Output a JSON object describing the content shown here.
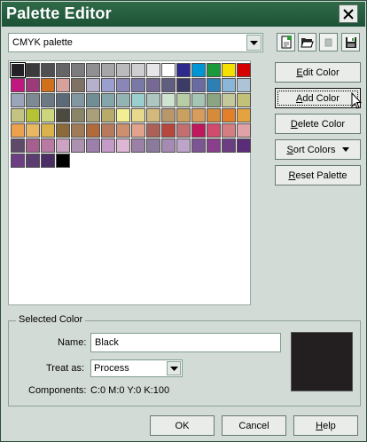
{
  "window": {
    "title": "Palette Editor"
  },
  "palette": {
    "selected": "CMYK palette",
    "swatches": [
      [
        "#222226",
        "#3b3b3e",
        "#505053",
        "#656568",
        "#7c7c7e",
        "#909092",
        "#a6a6a8",
        "#bbbbbd",
        "#cfcfd1",
        "#e6e6e8",
        "#ffffff",
        "#2d2a8c",
        "#0096d6",
        "#1a9a3b",
        "#f5e000",
        "#d50000"
      ],
      [
        "#c0187e",
        "#9d3a7a",
        "#d0701a",
        "#d7a09a",
        "#7d7264",
        "#b6b0cb",
        "#9b9fcf",
        "#8a86b8",
        "#7a78a5",
        "#766a94",
        "#5f5d80",
        "#3c3a66",
        "#6a6ba0",
        "#2d7fb4",
        "#8ab6da",
        "#adc4d6"
      ],
      [
        "#9aa5b9",
        "#7d8a94",
        "#6b7985",
        "#5a6a78",
        "#8297a0",
        "#6f8f95",
        "#84a5a9",
        "#93b4b3",
        "#9bcfcf",
        "#adc6c0",
        "#cfe3d1",
        "#b6cda5",
        "#a5c5b5",
        "#8aa57f",
        "#c4c89a",
        "#c3c178"
      ],
      [
        "#c4c482",
        "#b4c434",
        "#cdd67c",
        "#4c4a3e",
        "#8a8567",
        "#a9a07a",
        "#b8aa6a",
        "#f2ee94",
        "#e8d88c",
        "#d4b97d",
        "#b8976b",
        "#c8a062",
        "#d89c5c",
        "#d68b3b",
        "#e37f2b",
        "#e4a340"
      ],
      [
        "#eca14f",
        "#e8b862",
        "#d9b24c",
        "#8b6a3a",
        "#a17b57",
        "#b16a3a",
        "#b77a5d",
        "#cc8f6f",
        "#e2a38d",
        "#ac6158",
        "#b6473e",
        "#c36f72",
        "#c0185d",
        "#d04b6e",
        "#d57e82",
        "#e1a1a8"
      ],
      [
        "#5f4a6a",
        "#a56090",
        "#b87aa3",
        "#cba2c1",
        "#ad91b1",
        "#9d7fab",
        "#c49bc6",
        "#dcb6d3",
        "#9b7fa6",
        "#8a7a9c",
        "#a58bb4",
        "#bda4c8",
        "#7c5693",
        "#8a3f8d",
        "#6b3d82",
        "#5b2d79"
      ],
      [
        "#6c3f84",
        "#5c3d72",
        "#4b2e66",
        "#000000"
      ]
    ]
  },
  "toolbar": {
    "new_icon": "new-palette-icon",
    "open_icon": "open-folder-icon",
    "delete_icon": "delete-disabled-icon",
    "save_icon": "save-disk-icon"
  },
  "buttons": {
    "edit": "Edit Color",
    "add": "Add Color",
    "delete": "Delete Color",
    "sort": "Sort Colors",
    "reset": "Reset Palette"
  },
  "selected_color": {
    "group_label": "Selected Color",
    "name_label": "Name:",
    "name_value": "Black",
    "treat_label": "Treat as:",
    "treat_value": "Process",
    "components_label": "Components:",
    "components_value": "C:0 M:0 Y:0 K:100",
    "preview_color": "#231f20"
  },
  "footer": {
    "ok": "OK",
    "cancel": "Cancel",
    "help": "Help"
  }
}
